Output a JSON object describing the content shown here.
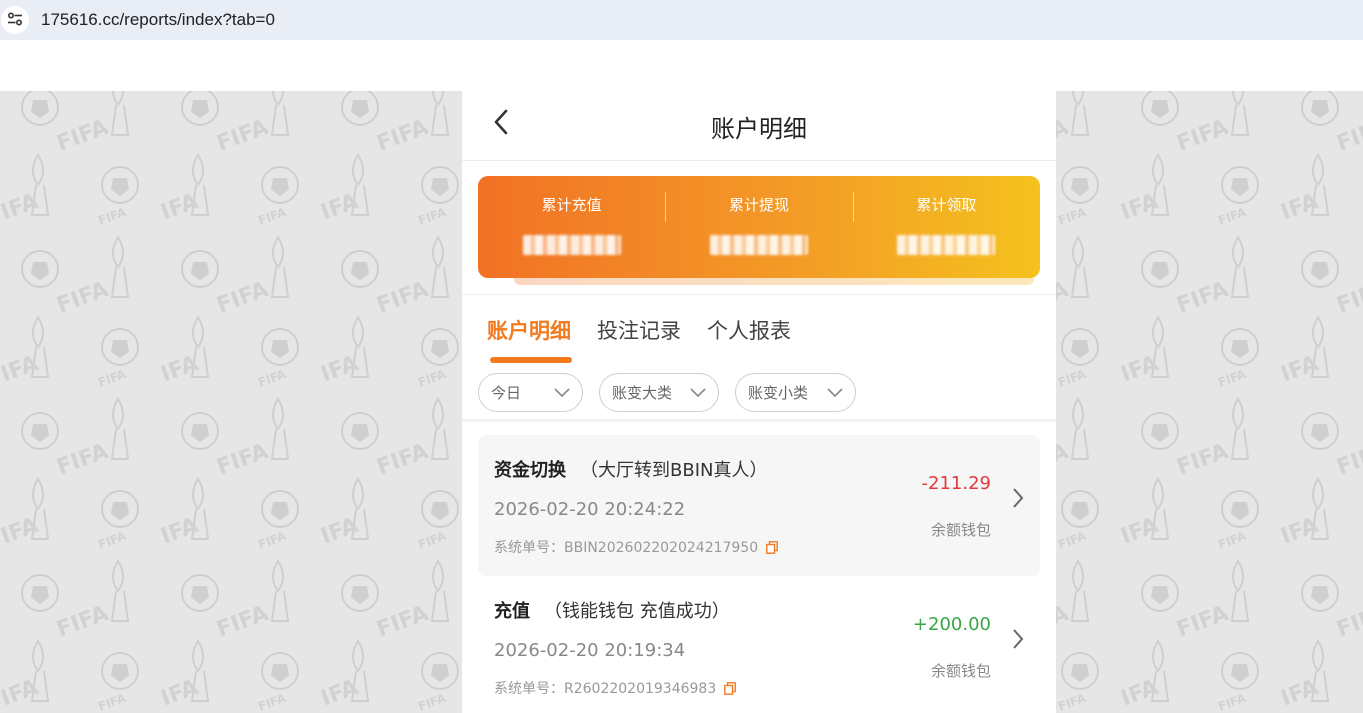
{
  "browser": {
    "url": "175616.cc/reports/index?tab=0",
    "site_info_icon": "tune-icon"
  },
  "header": {
    "title": "账户明细",
    "back_icon": "chevron-left-icon"
  },
  "summary": {
    "items": [
      {
        "label": "累计充值",
        "value_redacted": true
      },
      {
        "label": "累计提现",
        "value_redacted": true
      },
      {
        "label": "累计领取",
        "value_redacted": true
      }
    ],
    "gradient": [
      "#f27125",
      "#f5c21e"
    ]
  },
  "tabs": [
    {
      "label": "账户明细",
      "active": true
    },
    {
      "label": "投注记录",
      "active": false
    },
    {
      "label": "个人报表",
      "active": false
    }
  ],
  "filters": [
    {
      "label": "今日"
    },
    {
      "label": "账变大类"
    },
    {
      "label": "账变小类"
    }
  ],
  "records": [
    {
      "type": "资金切换",
      "desc": "（大厅转到BBIN真人）",
      "time": "2026-02-20 20:24:22",
      "order_label": "系统单号：",
      "order_no": "BBIN202602202024217950",
      "amount": "-211.29",
      "wallet": "余额钱包"
    },
    {
      "type": "充值",
      "desc": "（钱能钱包 充值成功）",
      "time": "2026-02-20 20:19:34",
      "order_label": "系统单号：",
      "order_no": "R2602202019346983",
      "amount": "+200.00",
      "wallet": "余额钱包"
    }
  ],
  "colors": {
    "accent": "#f47a20",
    "negative": "#e0393b",
    "positive": "#3aa546"
  }
}
